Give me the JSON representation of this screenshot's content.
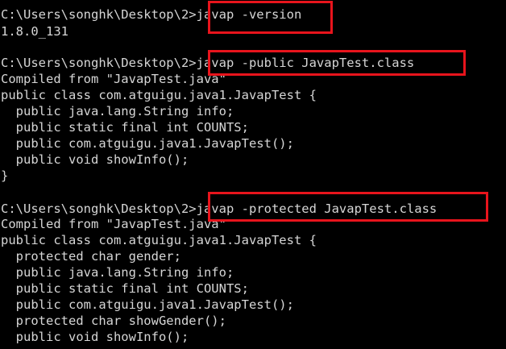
{
  "terminal": {
    "lines": [
      "C:\\Users\\songhk\\Desktop\\2>javap -version",
      "1.8.0_131",
      "",
      "C:\\Users\\songhk\\Desktop\\2>javap -public JavapTest.class",
      "Compiled from \"JavapTest.java\"",
      "public class com.atguigu.java1.JavapTest {",
      "  public java.lang.String info;",
      "  public static final int COUNTS;",
      "  public com.atguigu.java1.JavapTest();",
      "  public void showInfo();",
      "}",
      "",
      "C:\\Users\\songhk\\Desktop\\2>javap -protected JavapTest.class",
      "Compiled from \"JavapTest.java\"",
      "public class com.atguigu.java1.JavapTest {",
      "  protected char gender;",
      "  public java.lang.String info;",
      "  public static final int COUNTS;",
      "  public com.atguigu.java1.JavapTest();",
      "  protected char showGender();",
      "  public void showInfo();"
    ]
  },
  "highlight_color": "#e8141c",
  "text_color": "#d6d6d6",
  "background_color": "#000000"
}
